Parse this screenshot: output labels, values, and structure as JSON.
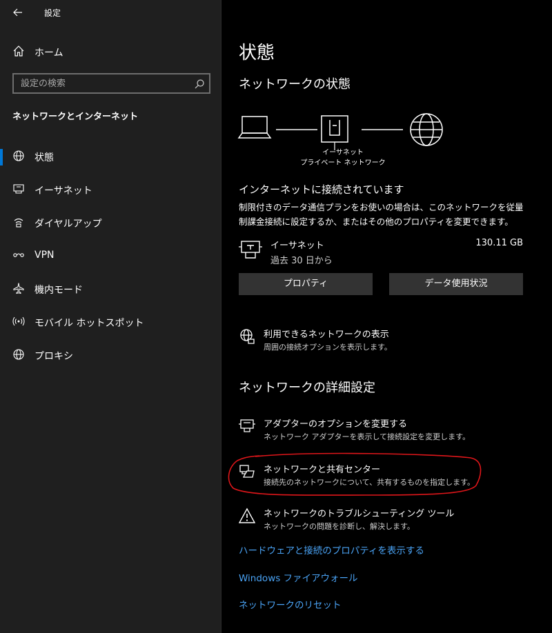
{
  "window": {
    "title": "設定"
  },
  "sidebar": {
    "home_label": "ホーム",
    "search_placeholder": "設定の検索",
    "section_title": "ネットワークとインターネット",
    "items": [
      {
        "label": "状態",
        "icon": "status-globe-icon",
        "active": true
      },
      {
        "label": "イーサネット",
        "icon": "ethernet-icon",
        "active": false
      },
      {
        "label": "ダイヤルアップ",
        "icon": "dialup-icon",
        "active": false
      },
      {
        "label": "VPN",
        "icon": "vpn-icon",
        "active": false
      },
      {
        "label": "機内モード",
        "icon": "airplane-icon",
        "active": false
      },
      {
        "label": "モバイル ホットスポット",
        "icon": "hotspot-icon",
        "active": false
      },
      {
        "label": "プロキシ",
        "icon": "proxy-globe-icon",
        "active": false
      }
    ]
  },
  "main": {
    "title": "状態",
    "network_status_heading": "ネットワークの状態",
    "diagram": {
      "label_line1": "イーサネット",
      "label_line2": "プライベート ネットワーク"
    },
    "connected_title": "インターネットに接続されています",
    "connected_desc": "制限付きのデータ通信プランをお使いの場合は、このネットワークを従量制課金接続に設定するか、またはその他のプロパティを変更できます。",
    "ethernet": {
      "name": "イーサネット",
      "period": "過去 30 日から",
      "usage": "130.11 GB"
    },
    "buttons": {
      "properties": "プロパティ",
      "data_usage": "データ使用状況"
    },
    "show_networks": {
      "title": "利用できるネットワークの表示",
      "desc": "周囲の接続オプションを表示します。"
    },
    "advanced_heading": "ネットワークの詳細設定",
    "adapter_options": {
      "title": "アダプターのオプションを変更する",
      "desc": "ネットワーク アダプターを表示して接続設定を変更します。"
    },
    "sharing_center": {
      "title": "ネットワークと共有センター",
      "desc": "接続先のネットワークについて、共有するものを指定します。"
    },
    "troubleshooter": {
      "title": "ネットワークのトラブルシューティング ツール",
      "desc": "ネットワークの問題を診断し、解決します。"
    },
    "links": {
      "hardware_properties": "ハードウェアと接続のプロパティを表示する",
      "firewall": "Windows ファイアウォール",
      "reset": "ネットワークのリセット"
    }
  },
  "colors": {
    "accent": "#0078d7",
    "link": "#4aa3f5",
    "annotation": "#e0161a",
    "sidebar_bg": "#1f1f1f",
    "button_bg": "#333333"
  }
}
